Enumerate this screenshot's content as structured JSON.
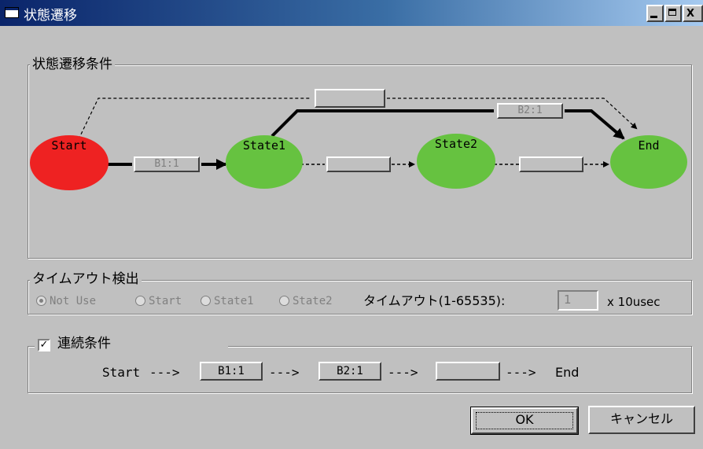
{
  "window": {
    "title": "状態遷移",
    "controls": {
      "minimize": "_",
      "maximize": "□",
      "close": "X"
    }
  },
  "transition_group": {
    "label": "状態遷移条件",
    "states": [
      {
        "name": "Start",
        "color": "#ee2222"
      },
      {
        "name": "State1",
        "color": "#66c240"
      },
      {
        "name": "State2",
        "color": "#66c240"
      },
      {
        "name": "End",
        "color": "#66c240"
      }
    ],
    "conditions": {
      "start_to_state1": "B1:1",
      "state1_to_state2": "",
      "state2_to_end": "",
      "state1_to_end": "B2:1",
      "start_to_end": ""
    }
  },
  "timeout_group": {
    "label": "タイムアウト検出",
    "radios": [
      {
        "label": "Not Use",
        "selected": true
      },
      {
        "label": "Start",
        "selected": false
      },
      {
        "label": "State1",
        "selected": false
      },
      {
        "label": "State2",
        "selected": false
      }
    ],
    "timeout_label": "タイムアウト(1-65535):",
    "timeout_value": "1",
    "unit": "x 10usec"
  },
  "sequence_group": {
    "checkbox_checked": true,
    "checkbox_mark": "✓",
    "label": "連続条件",
    "start": "Start",
    "arrow": "--->",
    "steps": [
      "B1:1",
      "B2:1",
      ""
    ],
    "end": "End"
  },
  "buttons": {
    "ok": "OK",
    "cancel": "キャンセル"
  }
}
